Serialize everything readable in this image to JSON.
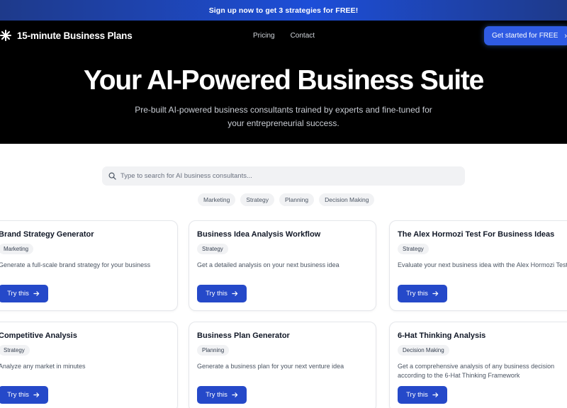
{
  "banner": {
    "text": "Sign up now to get 3 strategies for FREE!"
  },
  "header": {
    "logo_text": "15-minute Business Plans",
    "nav": [
      "Pricing",
      "Contact"
    ],
    "cta_label": "Get started for FREE"
  },
  "hero": {
    "title": "Your AI-Powered Business Suite",
    "subtitle": "Pre-built AI-powered business consultants trained by experts and fine-tuned for your entrepreneurial success."
  },
  "search": {
    "placeholder": "Type to search for AI business consultants..."
  },
  "categories": [
    "Marketing",
    "Strategy",
    "Planning",
    "Decision Making"
  ],
  "cards": [
    {
      "title": "Brand Strategy Generator",
      "tag": "Marketing",
      "description": "Generate a full-scale brand strategy for your business",
      "button": "Try this"
    },
    {
      "title": "Business Idea Analysis Workflow",
      "tag": "Strategy",
      "description": "Get a detailed analysis on your next business idea",
      "button": "Try this"
    },
    {
      "title": "The Alex Hormozi Test For Business Ideas",
      "tag": "Strategy",
      "description": "Evaluate your next business idea with the Alex Hormozi Test",
      "button": "Try this"
    },
    {
      "title": "Competitive Analysis",
      "tag": "Strategy",
      "description": "Analyze any market in minutes",
      "button": "Try this"
    },
    {
      "title": "Business Plan Generator",
      "tag": "Planning",
      "description": "Generate a business plan for your next venture idea",
      "button": "Try this"
    },
    {
      "title": "6-Hat Thinking Analysis",
      "tag": "Decision Making",
      "description": "Get a comprehensive analysis of any business decision according to the 6-Hat Thinking Framework",
      "button": "Try this"
    }
  ],
  "colors": {
    "accent": "#2549c9",
    "hero_bg": "#000000",
    "banner": "#1d4ed8"
  }
}
